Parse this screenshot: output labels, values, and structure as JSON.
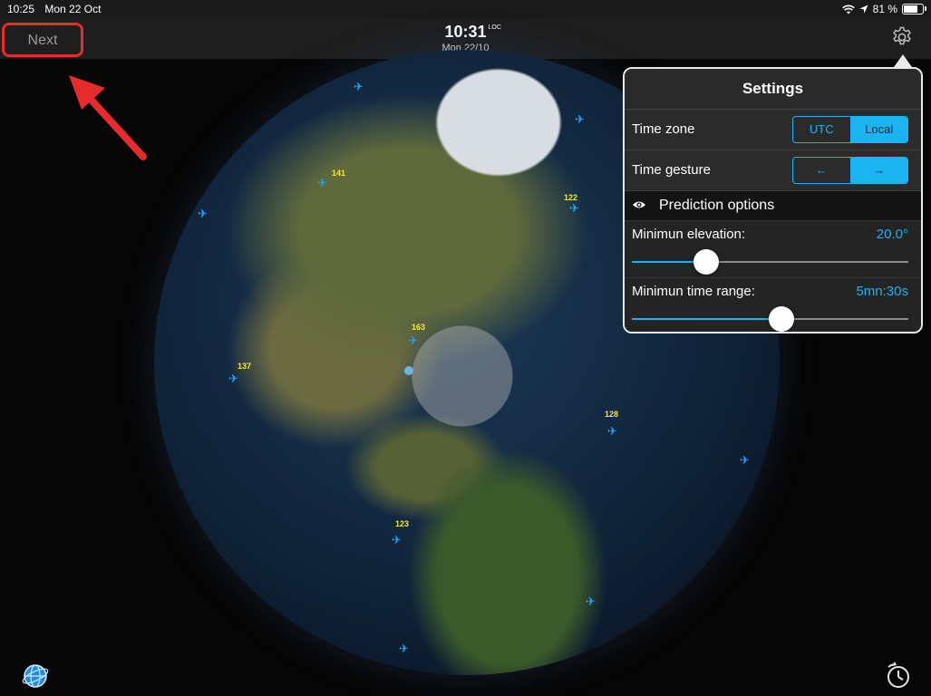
{
  "status_bar": {
    "time": "10:25",
    "date": "Mon 22 Oct",
    "battery": "81 %",
    "battery_level": 0.81
  },
  "nav": {
    "next_label": "Next",
    "clock_time": "10:31",
    "clock_zone": "LOC",
    "clock_date": "Mon 22/10"
  },
  "settings": {
    "title": "Settings",
    "time_zone": {
      "label": "Time zone",
      "options": [
        "UTC",
        "Local"
      ],
      "selected": "Local"
    },
    "time_gesture": {
      "label": "Time gesture",
      "options": [
        "←",
        "→"
      ],
      "selected": "→"
    },
    "prediction_header": "Prediction options",
    "min_elevation": {
      "label": "Minimun elevation:",
      "value": "20.0°",
      "position": 0.27
    },
    "min_time_range": {
      "label": "Minimun time range:",
      "value": "5mn:30s",
      "position": 0.54
    }
  },
  "satellites": [
    {
      "label": "141"
    },
    {
      "label": "122"
    },
    {
      "label": "163"
    },
    {
      "label": "137"
    },
    {
      "label": "128"
    },
    {
      "label": "123"
    }
  ],
  "colors": {
    "accent": "#1cb4f0",
    "annotation": "#e52b2b",
    "satellite": "#1fa3ff",
    "satellite_label": "#f5e83c"
  },
  "icons": {
    "settings": "gear-icon",
    "globe_view": "globe-icon",
    "time": "clock-icon",
    "prediction": "eye-icon"
  }
}
